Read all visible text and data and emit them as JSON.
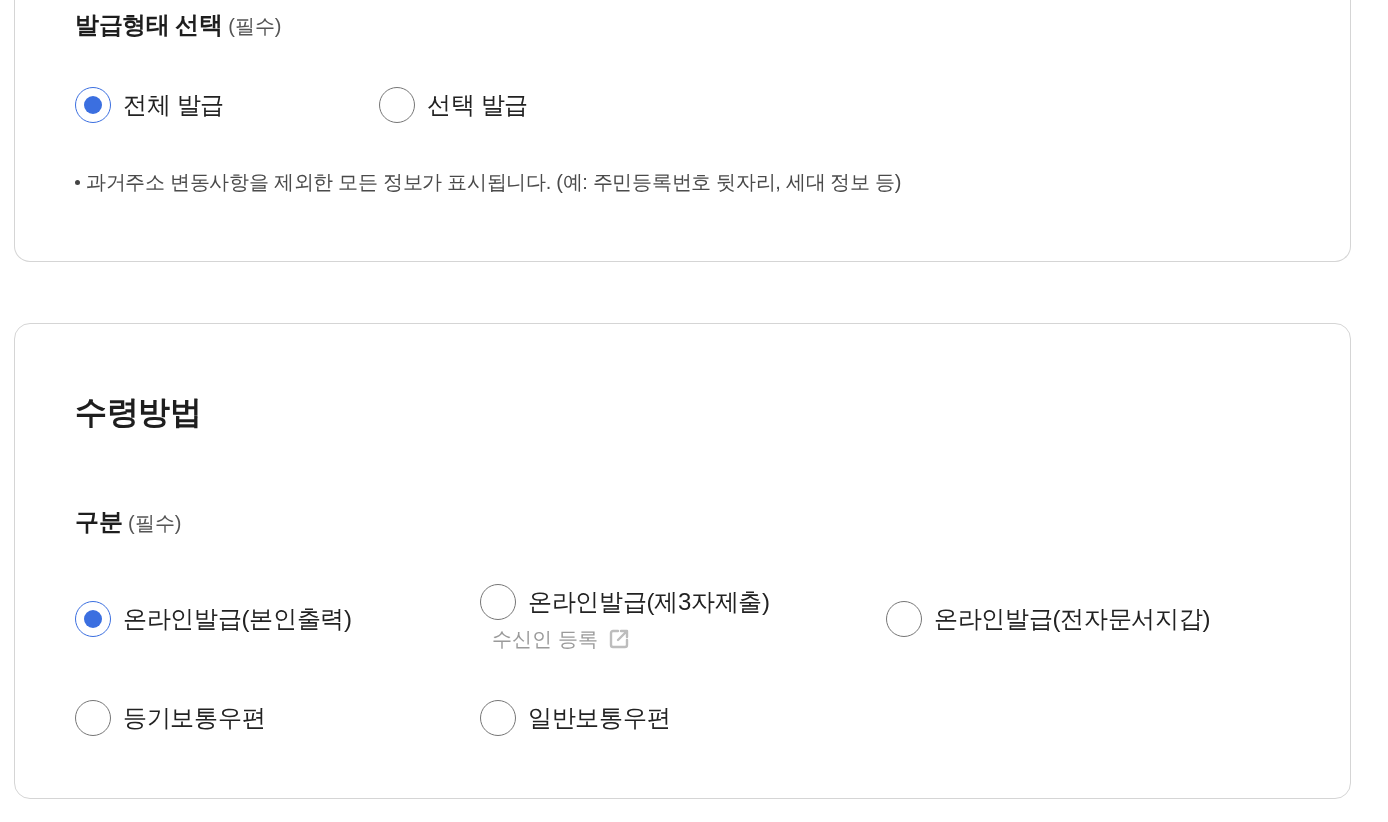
{
  "issue_type": {
    "title": "발급형태 선택",
    "required": "(필수)",
    "options": [
      {
        "label": "전체 발급",
        "selected": true
      },
      {
        "label": "선택 발급",
        "selected": false
      }
    ],
    "note": "과거주소 변동사항을 제외한 모든 정보가 표시됩니다. (예: 주민등록번호 뒷자리, 세대 정보 등)"
  },
  "receipt": {
    "title": "수령방법",
    "field_label": "구분",
    "required": "(필수)",
    "options": [
      {
        "label": "온라인발급(본인출력)",
        "selected": true
      },
      {
        "label": "온라인발급(제3자제출)",
        "selected": false,
        "link": "수신인 등록"
      },
      {
        "label": "온라인발급(전자문서지갑)",
        "selected": false
      },
      {
        "label": "등기보통우편",
        "selected": false
      },
      {
        "label": "일반보통우편",
        "selected": false
      }
    ]
  }
}
